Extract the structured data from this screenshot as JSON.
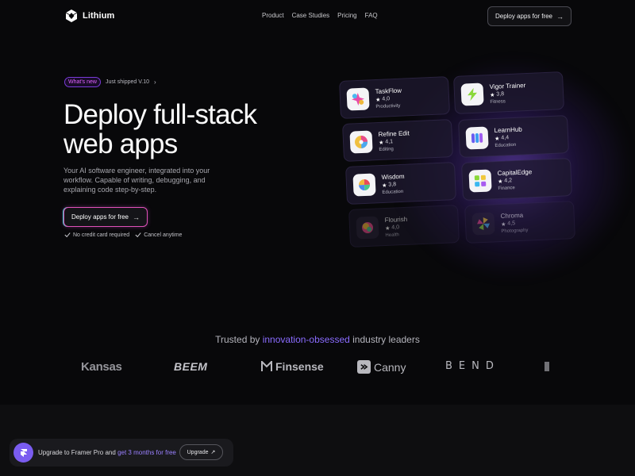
{
  "nav": {
    "brand": "Lithium",
    "links": [
      "Product",
      "Case Studies",
      "Pricing",
      "FAQ"
    ],
    "cta_label": "Deploy apps for free"
  },
  "hero": {
    "badge": "What's new",
    "badge_text": "Just shipped V.10",
    "title_line1": "Deploy full-stack",
    "title_line2": "web apps",
    "subtitle": "Your AI software engineer, integrated into your workflow. Capable of writing, debugging, and explaining code step-by-step.",
    "cta_label": "Deploy apps for free",
    "checks": [
      "No credit card required",
      "Cancel anytime"
    ]
  },
  "apps": [
    {
      "name": "TaskFlow",
      "rating": "4,0",
      "category": "Productivity",
      "icon": "taskflow-icon"
    },
    {
      "name": "Vigor Trainer",
      "rating": "3,8",
      "category": "Fitness",
      "icon": "bolt-icon"
    },
    {
      "name": "Refine Edit",
      "rating": "4,1",
      "category": "Editing",
      "icon": "prism-icon"
    },
    {
      "name": "LearnHub",
      "rating": "4,4",
      "category": "Education",
      "icon": "wave-icon"
    },
    {
      "name": "Wisdom",
      "rating": "3,8",
      "category": "Education",
      "icon": "swirl-icon"
    },
    {
      "name": "CapitalEdge",
      "rating": "4,2",
      "category": "Finance",
      "icon": "blocks-icon"
    },
    {
      "name": "Flourish",
      "rating": "4,0",
      "category": "Health",
      "icon": "orb-icon"
    },
    {
      "name": "Chroma",
      "rating": "4,5",
      "category": "Photography",
      "icon": "pinwheel-icon"
    }
  ],
  "trusted": {
    "prefix": "Trusted by",
    "highlight": "innovation-obsessed",
    "suffix": "industry leaders"
  },
  "logos": [
    "Kansas",
    "BEEM",
    "Finsense",
    "Canny",
    "BEND"
  ],
  "framer": {
    "text_prefix": "Upgrade to Framer Pro and",
    "text_highlight": "get 3 months for free",
    "button_label": "Upgrade"
  },
  "colors": {
    "background": "#08080a",
    "accent_purple": "#7a5cf0",
    "highlight_text": "#8a6cff"
  }
}
